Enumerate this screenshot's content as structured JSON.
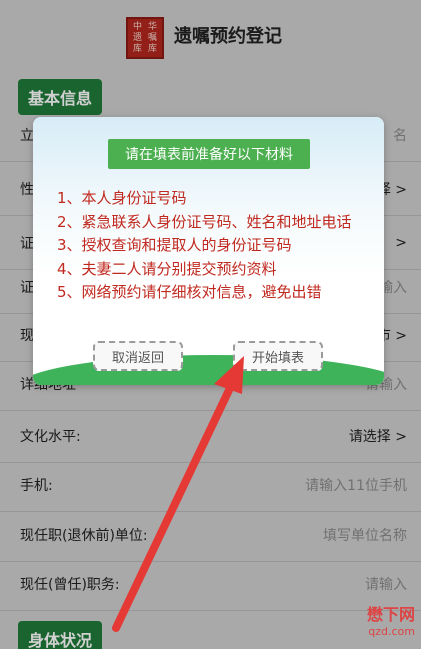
{
  "header": {
    "title": "遗嘱预约登记",
    "logo_glyphs": [
      "中",
      "华",
      "遗",
      "嘱",
      "库",
      "库"
    ]
  },
  "sections": {
    "basic": "基本信息",
    "body": "身体状况"
  },
  "form_rows": [
    {
      "label": "立",
      "value": "名"
    },
    {
      "label": "性",
      "value": "择 >"
    },
    {
      "label": "证",
      "value": ">"
    },
    {
      "label": "证",
      "value": "输入"
    },
    {
      "label": "现",
      "value": "市 >"
    },
    {
      "label": "详细地址",
      "value": "请输入"
    },
    {
      "label": "文化水平:",
      "value": "请选择 >"
    },
    {
      "label": "手机:",
      "value": "请输入11位手机"
    },
    {
      "label": "现任职(退休前)单位:",
      "value": "填写单位名称"
    },
    {
      "label": "现任(曾任)职务:",
      "value": "请输入"
    }
  ],
  "dialog": {
    "title": "请在填表前准备好以下材料",
    "items": [
      "1、本人身份证号码",
      "2、紧急联系人身份证号码、姓名和地址电话",
      "3、授权查询和提取人的身份证号码",
      "4、夫妻二人请分别提交预约资料",
      "5、网络预约请仔细核对信息，避免出错"
    ],
    "cancel_label": "取消返回",
    "start_label": "开始填表"
  },
  "watermark": {
    "line1": "懋下网",
    "line2": "qzd.com"
  },
  "colors": {
    "accent_green": "#1f7a3a",
    "dialog_green": "#4caf50",
    "red_text": "#c0291f",
    "arrow_red": "#e53935"
  }
}
